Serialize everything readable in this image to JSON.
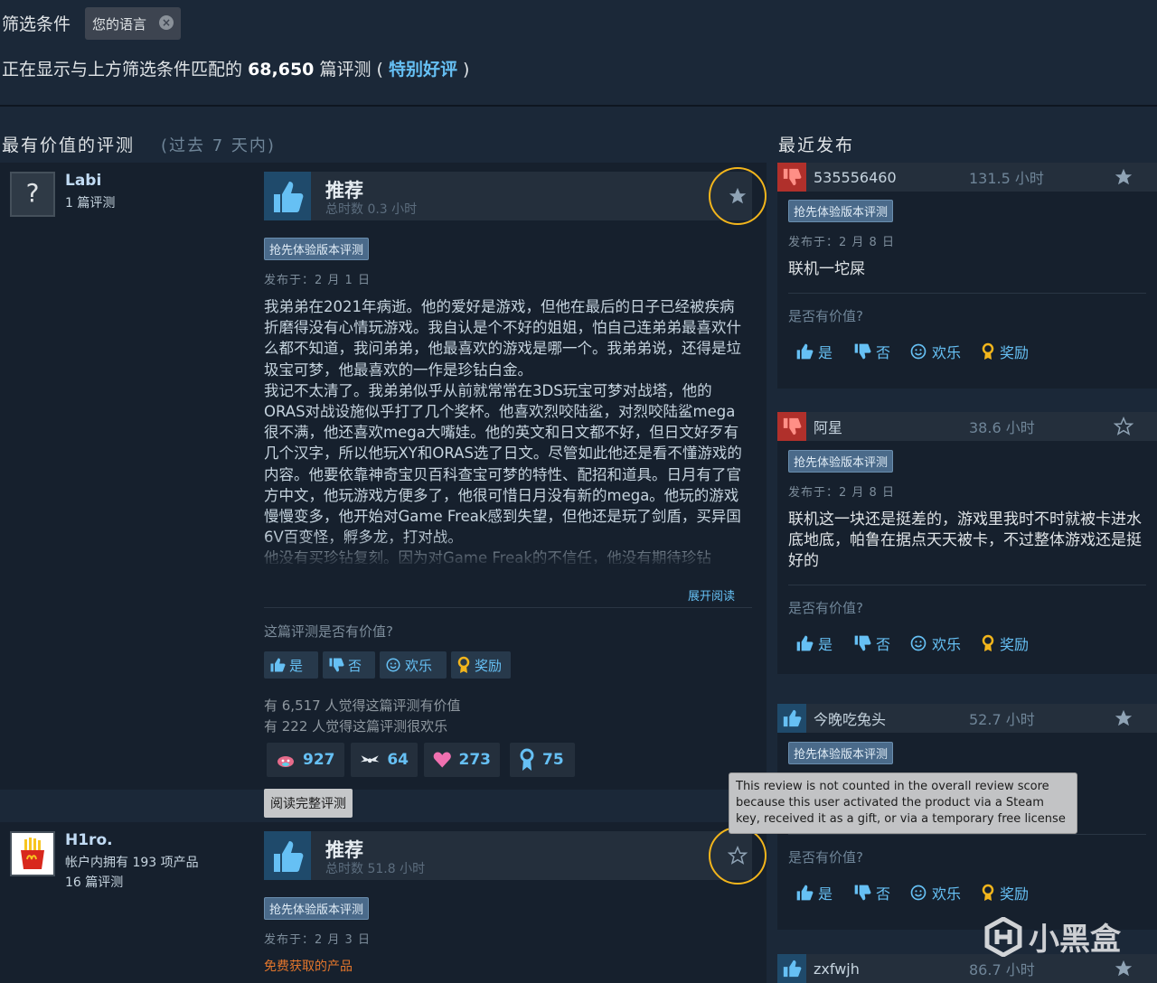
{
  "filters": {
    "label": "筛选条件",
    "chip": "您的语言"
  },
  "summary": {
    "prefix": "正在显示与上方筛选条件匹配的",
    "count": "68,650",
    "suffix": "篇评测 (",
    "rating": "特别好评",
    "close": ")"
  },
  "left_section": {
    "title": "最有价值的评测",
    "subtitle": "(过去 7 天内)"
  },
  "right_section": {
    "title": "最近发布"
  },
  "reviews": [
    {
      "username": "Labi",
      "meta1": "1 篇评测",
      "verdict": "推荐",
      "hours": "总时数 0.3 小时",
      "badge": "抢先体验版本评测",
      "posted": "发布于：2 月 1 日",
      "text": "我弟弟在2021年病逝。他的爱好是游戏，但他在最后的日子已经被疾病折磨得没有心情玩游戏。我自认是个不好的姐姐，怕自己连弟弟最喜欢什么都不知道，我问弟弟，他最喜欢的游戏是哪一个。我弟弟说，还得是垃圾宝可梦，他最喜欢的一作是珍钻白金。\n我记不太清了。我弟弟似乎从前就常常在3DS玩宝可梦对战塔，他的ORAS对战设施似乎打了几个奖杯。他喜欢烈咬陆鲨，对烈咬陆鲨mega很不满，他还喜欢mega大嘴娃。他的英文和日文都不好，但日文好歹有几个汉字，所以他玩XY和ORAS选了日文。尽管如此他还是看不懂游戏的内容。他要依靠神奇宝贝百科查宝可梦的特性、配招和道具。日月有了官方中文，他玩游戏方便多了，他很可惜日月没有新的mega。他玩的游戏慢慢变多，他开始对Game Freak感到失望，但他还是玩了剑盾，买异国6V百变怪，孵多龙，打对战。\n他没有买珍钻复刻。因为对Game Freak的不信任，他没有期待珍钻",
      "read_more": "展开阅读",
      "helpful_q": "这篇评测是否有价值?",
      "yes": "是",
      "no": "否",
      "funny": "欢乐",
      "award": "奖励",
      "helpful_count": "有 6,517 人觉得这篇评测有价值",
      "funny_count": "有 222 人觉得这篇评测很欢乐",
      "awards": [
        {
          "icon": "wholesome-icon",
          "value": "927"
        },
        {
          "icon": "winged-icon",
          "value": "64"
        },
        {
          "icon": "heart-icon",
          "value": "273"
        },
        {
          "icon": "ribbon-icon",
          "value": "75"
        }
      ],
      "full_review": "阅读完整评测"
    },
    {
      "username": "H1ro.",
      "meta1": "帐户内拥有 193 项产品",
      "meta2": "16 篇评测",
      "verdict": "推荐",
      "hours": "总时数 51.8 小时",
      "badge": "抢先体验版本评测",
      "posted": "发布于：2 月 3 日",
      "free_product": "免费获取的产品"
    }
  ],
  "tooltip": "This review is not counted in the overall review score because this user activated the product via a Steam key, received it as a gift, or via a temporary free license",
  "recent": [
    {
      "name": "535556460",
      "hours": "131.5 小时",
      "vote": "down",
      "badge": "抢先体验版本评测",
      "posted": "发布于：2 月 8 日",
      "text": "联机一坨屎",
      "helpful": "是否有价值?",
      "yes": "是",
      "no": "否",
      "funny": "欢乐",
      "award": "奖励"
    },
    {
      "name": "阿星",
      "hours": "38.6 小时",
      "vote": "down",
      "badge": "抢先体验版本评测",
      "posted": "发布于：2 月 8 日",
      "text": "联机这一块还是挺差的，游戏里我时不时就被卡进水底地底，帕鲁在据点天天被卡，不过整体游戏还是挺好的",
      "helpful": "是否有价值?",
      "yes": "是",
      "no": "否",
      "funny": "欢乐",
      "award": "奖励"
    },
    {
      "name": "今晚吃兔头",
      "hours": "52.7 小时",
      "vote": "up",
      "badge": "抢先体验版本评测",
      "helpful": "是否有价值?",
      "yes": "是",
      "no": "否",
      "funny": "欢乐",
      "award": "奖励"
    },
    {
      "name": "zxfwjh",
      "hours": "86.7 小时",
      "vote": "up"
    }
  ],
  "watermark": "小黑盒",
  "colors": {
    "bg": "#1b2838",
    "accent": "#66c0f4",
    "star_highlight": "#f2b51c",
    "thumb_down": "#c0392b"
  }
}
